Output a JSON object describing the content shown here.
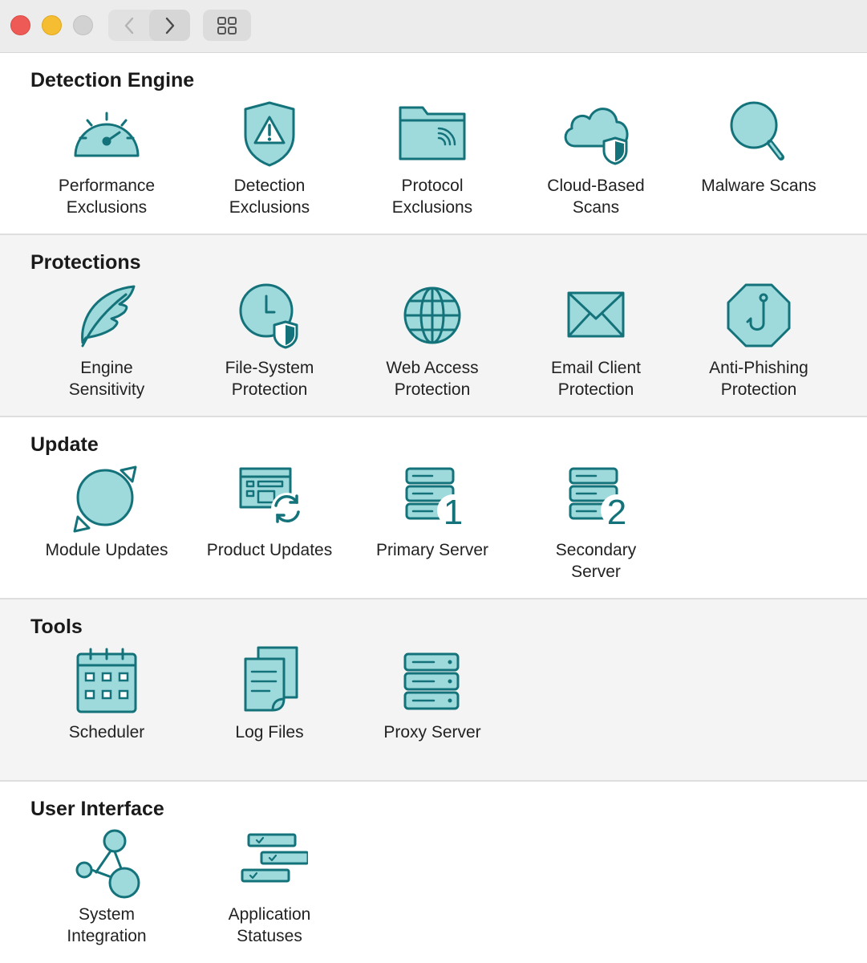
{
  "titlebar": {
    "back_icon": "chevron-left-icon",
    "forward_icon": "chevron-right-icon",
    "view_icon": "grid-icon"
  },
  "sections": [
    {
      "title": "Detection Engine",
      "items": [
        {
          "label": "Performance\nExclusions",
          "icon": "speedometer-icon"
        },
        {
          "label": "Detection\nExclusions",
          "icon": "shield-warning-icon"
        },
        {
          "label": "Protocol\nExclusions",
          "icon": "folder-signal-icon"
        },
        {
          "label": "Cloud-Based\nScans",
          "icon": "cloud-shield-icon"
        },
        {
          "label": "Malware Scans",
          "icon": "magnifier-icon"
        }
      ]
    },
    {
      "title": "Protections",
      "items": [
        {
          "label": "Engine\nSensitivity",
          "icon": "feather-icon"
        },
        {
          "label": "File-System\nProtection",
          "icon": "clock-shield-icon"
        },
        {
          "label": "Web Access\nProtection",
          "icon": "globe-icon"
        },
        {
          "label": "Email Client\nProtection",
          "icon": "envelope-icon"
        },
        {
          "label": "Anti-Phishing\nProtection",
          "icon": "fishhook-icon"
        }
      ]
    },
    {
      "title": "Update",
      "items": [
        {
          "label": "Module Updates",
          "icon": "refresh-arrows-icon"
        },
        {
          "label": "Product Updates",
          "icon": "app-refresh-icon"
        },
        {
          "label": "Primary Server",
          "icon": "server-1-icon"
        },
        {
          "label": "Secondary\nServer",
          "icon": "server-2-icon"
        }
      ]
    },
    {
      "title": "Tools",
      "items": [
        {
          "label": "Scheduler",
          "icon": "calendar-icon"
        },
        {
          "label": "Log Files",
          "icon": "documents-icon"
        },
        {
          "label": "Proxy Server",
          "icon": "server-stack-icon"
        }
      ]
    },
    {
      "title": "User Interface",
      "items": [
        {
          "label": "System\nIntegration",
          "icon": "network-nodes-icon"
        },
        {
          "label": "Application\nStatuses",
          "icon": "status-list-icon"
        }
      ]
    }
  ],
  "colors": {
    "icon_fill": "#9ed9dc",
    "icon_stroke": "#14737a",
    "alt_section_bg": "#f4f4f4",
    "close": "#ee5b56",
    "minimize": "#f5be32",
    "zoom_disabled": "#d2d2d2"
  }
}
